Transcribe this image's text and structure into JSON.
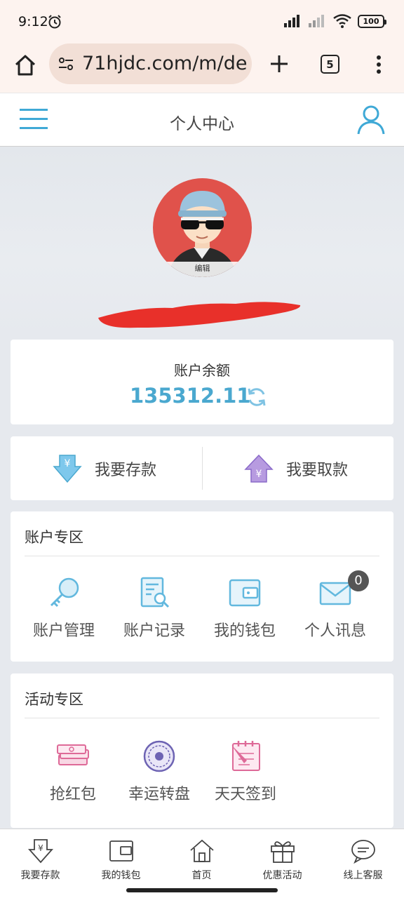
{
  "status": {
    "time": "9:12",
    "battery": "100"
  },
  "browser": {
    "url": "71hjdc.com/m/de",
    "tab_count": "5"
  },
  "header": {
    "title": "个人中心"
  },
  "profile": {
    "edit_label": "编辑"
  },
  "balance": {
    "label": "账户余额",
    "value": "135312.11"
  },
  "actions": {
    "deposit": "我要存款",
    "withdraw": "我要取款"
  },
  "account_zone": {
    "title": "账户专区",
    "items": [
      {
        "label": "账户管理",
        "icon": "key-icon"
      },
      {
        "label": "账户记录",
        "icon": "record-icon"
      },
      {
        "label": "我的钱包",
        "icon": "wallet-icon"
      },
      {
        "label": "个人讯息",
        "icon": "mail-icon",
        "badge": "0"
      }
    ]
  },
  "activity_zone": {
    "title": "活动专区",
    "items": [
      {
        "label": "抢红包",
        "icon": "money-stack-icon"
      },
      {
        "label": "幸运转盘",
        "icon": "wheel-icon"
      },
      {
        "label": "天天签到",
        "icon": "calendar-sign-icon"
      }
    ]
  },
  "bottom_nav": [
    {
      "label": "我要存款",
      "icon": "deposit-icon"
    },
    {
      "label": "我的钱包",
      "icon": "wallet-icon"
    },
    {
      "label": "首页",
      "icon": "home-icon"
    },
    {
      "label": "优惠活动",
      "icon": "gift-icon"
    },
    {
      "label": "线上客服",
      "icon": "chat-icon"
    }
  ],
  "colors": {
    "accent": "#4aa8cf",
    "avatar_bg": "#e0524b",
    "redact": "#e8302a"
  }
}
